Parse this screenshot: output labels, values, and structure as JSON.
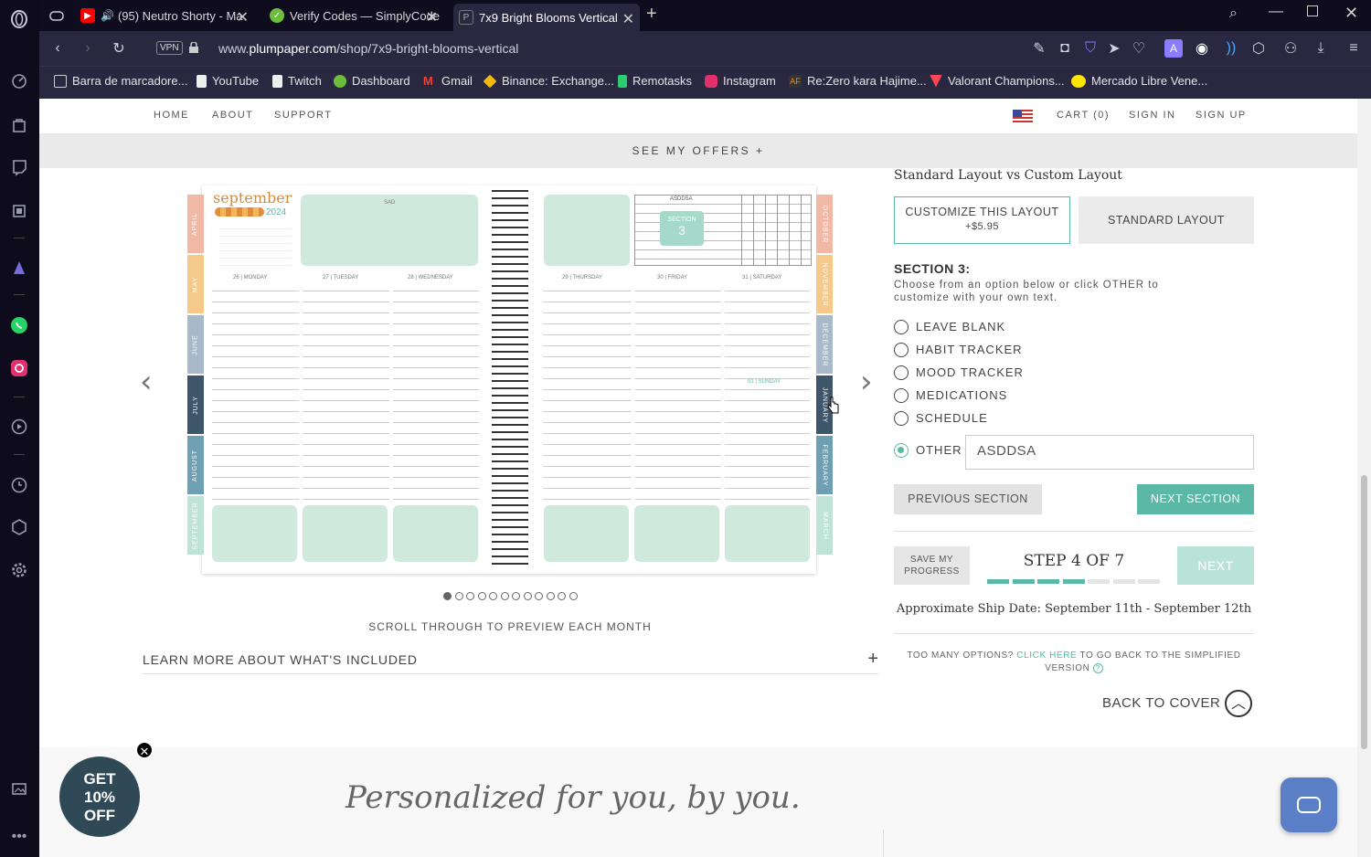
{
  "browser": {
    "tabs": [
      {
        "title": "(95) Neutro Shorty - Ma",
        "favicon": "youtube-icon",
        "color": "#ff0000"
      },
      {
        "title": "Verify Codes — SimplyCode",
        "favicon": "simplycodes-icon",
        "color": "#6bbf3a"
      },
      {
        "title": "7x9 Bright Blooms Vertical",
        "favicon": "plumpaper-icon",
        "color": "#888888"
      }
    ],
    "url_prefix": "www.",
    "url_domain": "plumpaper.com",
    "url_path": "/shop/7x9-bright-blooms-vertical",
    "vpn_label": "VPN",
    "bookmarks": [
      {
        "label": "Barra de marcadore...",
        "icon": "folder-icon"
      },
      {
        "label": "YouTube",
        "icon": "page-icon"
      },
      {
        "label": "Twitch",
        "icon": "page-icon"
      },
      {
        "label": "Dashboard",
        "icon": "dashboard-icon"
      },
      {
        "label": "Gmail",
        "icon": "gmail-icon"
      },
      {
        "label": "Binance: Exchange...",
        "icon": "binance-icon"
      },
      {
        "label": "Remotasks",
        "icon": "remotasks-icon"
      },
      {
        "label": "Instagram",
        "icon": "instagram-icon"
      },
      {
        "label": "Re:Zero kara Hajime...",
        "icon": "af-icon"
      },
      {
        "label": "Valorant Champions...",
        "icon": "valorant-icon"
      },
      {
        "label": "Mercado Libre Vene...",
        "icon": "mercadolibre-icon"
      }
    ]
  },
  "site": {
    "nav": {
      "home": "HOME",
      "about": "ABOUT",
      "support": "SUPPORT",
      "cart": "CART (0)",
      "sign_in": "SIGN IN",
      "sign_up": "SIGN UP"
    },
    "offers": "SEE MY OFFERS  +",
    "planner": {
      "month_title": "september",
      "year": "2024",
      "left_tabs": [
        "APRIL",
        "MAY",
        "JUNE",
        "JULY",
        "AUGUST",
        "SEPTEMBER"
      ],
      "right_tabs": [
        "OCTOBER",
        "NOVEMBER",
        "DECEMBER",
        "JANUARY",
        "FEBRUARY",
        "MARCH"
      ],
      "day_headers": [
        "26 | MONDAY",
        "27 | TUESDAY",
        "28 | WEDNESDAY",
        "29 | THURSDAY",
        "30 | FRIDAY",
        "31 | SATURDAY"
      ],
      "sunday_header": "01 | SUNDAY",
      "box_label": "SAD",
      "tracker_label": "ASDDSA",
      "tracker_days": [
        "M",
        "T",
        "W",
        "T",
        "F",
        "S",
        "S"
      ],
      "section_label": "SECTION",
      "section_number": "3"
    },
    "carousel": {
      "dots": 12,
      "active_index": 0
    },
    "scroll_caption": "SCROLL THROUGH TO PREVIEW EACH MONTH",
    "learn_more": "LEARN MORE ABOUT WHAT'S INCLUDED",
    "learn_more_plus": "+",
    "layout_heading": "Standard Layout vs Custom Layout",
    "customize_btn": "CUSTOMIZE THIS LAYOUT",
    "customize_price": "+$5.95",
    "standard_btn": "STANDARD LAYOUT",
    "section_title": "SECTION 3:",
    "section_desc": "Choose from an option below or click OTHER to customize with your own text.",
    "options": [
      "LEAVE BLANK",
      "HABIT TRACKER",
      "MOOD TRACKER",
      "MEDICATIONS",
      "SCHEDULE"
    ],
    "other_label": "OTHER",
    "other_value": "ASDDSA",
    "prev_section": "PREVIOUS SECTION",
    "next_section": "NEXT SECTION",
    "save_progress": "SAVE MY PROGRESS",
    "step_text": "STEP 4 OF 7",
    "step_current": 4,
    "step_total": 7,
    "next": "NEXT",
    "ship_date": "Approximate Ship Date: September 11th - September 12th",
    "too_many": "TOO MANY OPTIONS?",
    "click_here": "CLICK HERE",
    "simplified": "TO GO BACK TO THE SIMPLIFIED",
    "version": "VERSION",
    "back_to_cover": "BACK TO COVER",
    "promo": {
      "line1": "GET",
      "line2": "10%",
      "line3": "OFF"
    },
    "footer_script": "Personalized for you, by you."
  },
  "colors": {
    "accent": "#5bb8a6",
    "accent_light": "#b9e3d9",
    "promo": "#2f4a56",
    "mint": "#cfeadd"
  }
}
